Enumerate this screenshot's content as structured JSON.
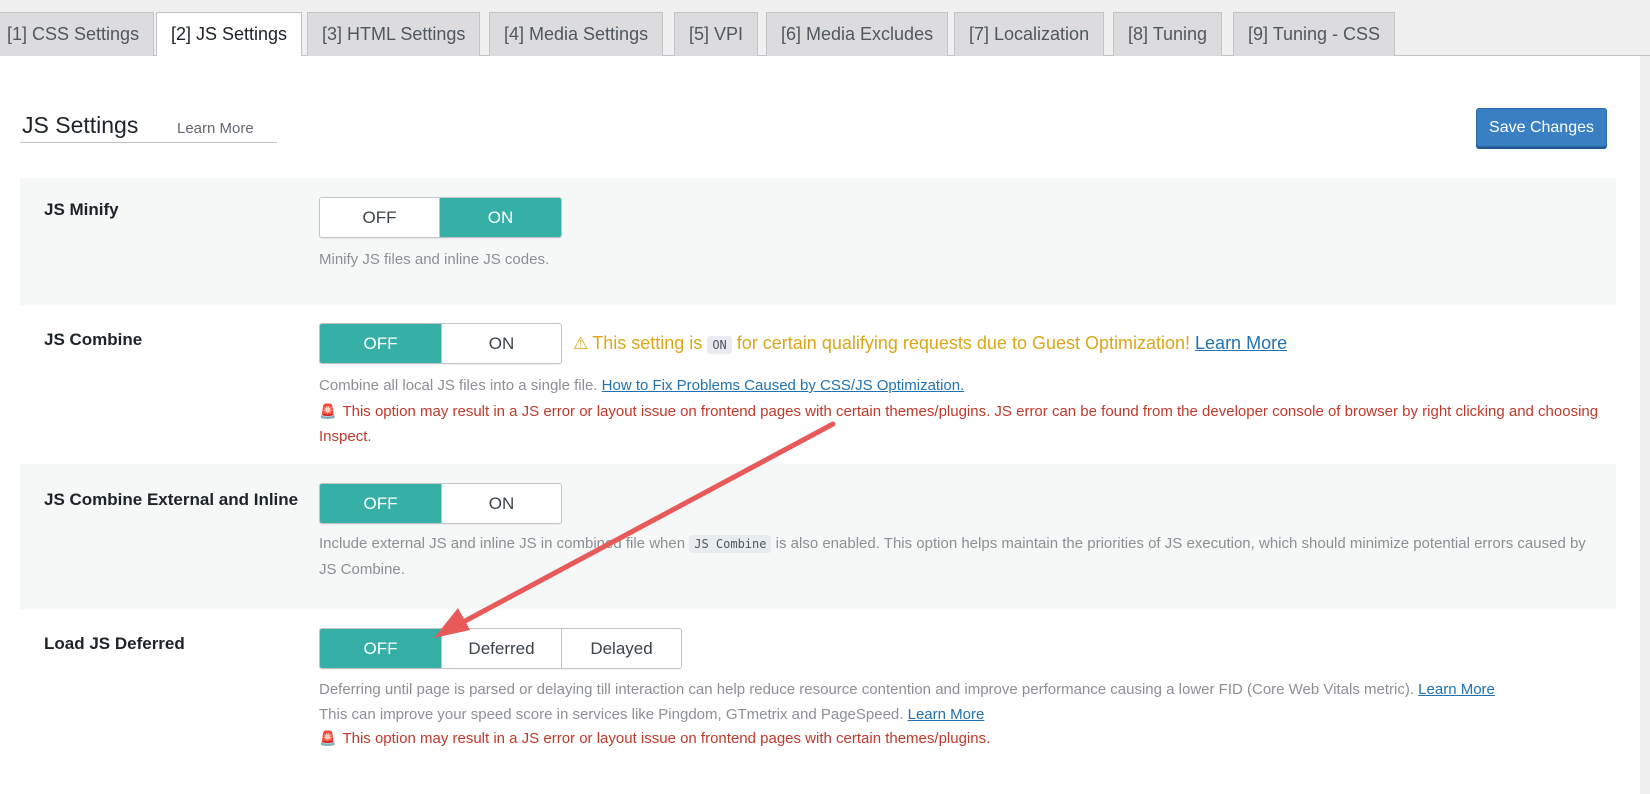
{
  "tabs": [
    {
      "label": "[1] CSS Settings"
    },
    {
      "label": "[2] JS Settings"
    },
    {
      "label": "[3] HTML Settings"
    },
    {
      "label": "[4] Media Settings"
    },
    {
      "label": "[5] VPI"
    },
    {
      "label": "[6] Media Excludes"
    },
    {
      "label": "[7] Localization"
    },
    {
      "label": "[8] Tuning"
    },
    {
      "label": "[9] Tuning - CSS"
    }
  ],
  "header": {
    "title": "JS Settings",
    "learn_more": "Learn More",
    "save_label": "Save Changes"
  },
  "settings": {
    "js_minify": {
      "label": "JS Minify",
      "options": [
        "OFF",
        "ON"
      ],
      "selected": "ON",
      "description": "Minify JS files and inline JS codes."
    },
    "js_combine": {
      "label": "JS Combine",
      "options": [
        "OFF",
        "ON"
      ],
      "selected": "OFF",
      "notice_pre": "This setting is",
      "notice_code": "ON",
      "notice_post": "for certain qualifying requests due to Guest Optimization!",
      "notice_link": "Learn More",
      "description": "Combine all local JS files into a single file.",
      "description_link": "How to Fix Problems Caused by CSS/JS Optimization.",
      "danger": "This option may result in a JS error or layout issue on frontend pages with certain themes/plugins. JS error can be found from the developer console of browser by right clicking and choosing Inspect."
    },
    "js_combine_ext": {
      "label": "JS Combine External and Inline",
      "options": [
        "OFF",
        "ON"
      ],
      "selected": "OFF",
      "description_pre": "Include external JS and inline JS in combined file when",
      "description_code": "JS Combine",
      "description_post": "is also enabled. This option helps maintain the priorities of JS execution, which should minimize potential errors caused by JS Combine."
    },
    "load_js_deferred": {
      "label": "Load JS Deferred",
      "options": [
        "OFF",
        "Deferred",
        "Delayed"
      ],
      "selected": "OFF",
      "description1": "Deferring until page is parsed or delaying till interaction can help reduce resource contention and improve performance causing a lower FID (Core Web Vitals metric).",
      "description1_link": "Learn More",
      "description2": "This can improve your speed score in services like Pingdom, GTmetrix and PageSpeed.",
      "description2_link": "Learn More",
      "danger": "This option may result in a JS error or layout issue on frontend pages with certain themes/plugins."
    }
  },
  "colors": {
    "accent": "#36b0a6",
    "save_button": "#3a7fc2",
    "warning": "#dba617",
    "danger": "#c0392b",
    "annotation_arrow": "#e85a5a"
  }
}
